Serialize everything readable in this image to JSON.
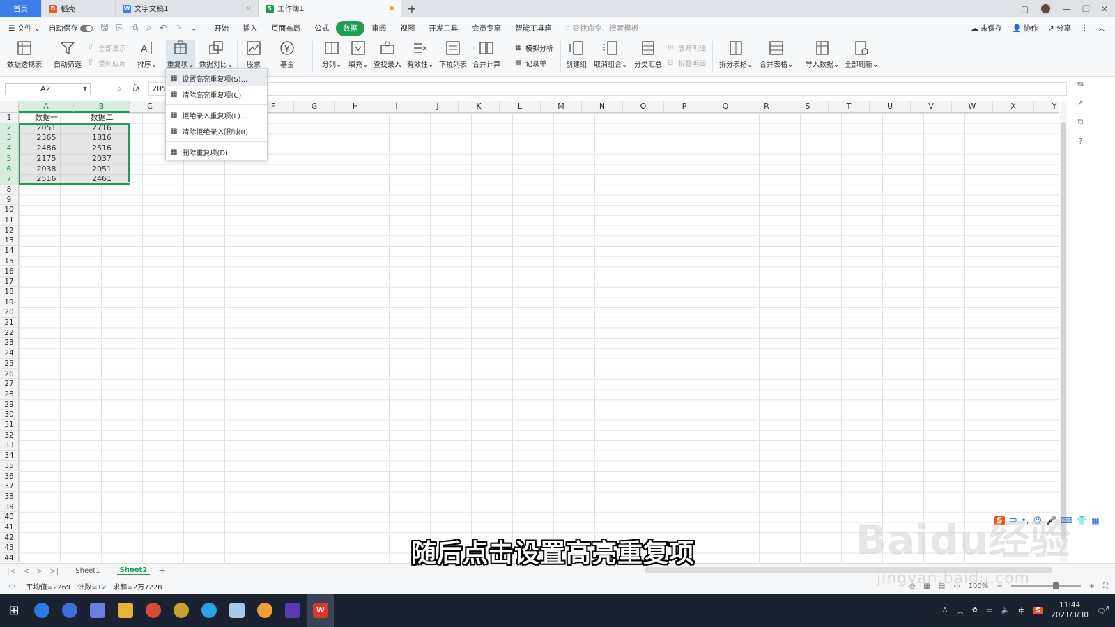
{
  "tabs": {
    "home": "首页",
    "doc1": "稻壳",
    "doc2": "文字文稿1",
    "doc3": "工作簿1"
  },
  "menubar": {
    "file": "文件",
    "autosave": "自动保存",
    "tabs": [
      "开始",
      "插入",
      "页面布局",
      "公式",
      "数据",
      "审阅",
      "视图",
      "开发工具",
      "会员专享",
      "智能工具箱"
    ],
    "active_tab": "数据",
    "search_placeholder": "查找命令、搜索模板",
    "unsaved": "未保存",
    "collab": "协作",
    "share": "分享"
  },
  "ribbon": {
    "pivot": "数据透视表",
    "autofilter": "自动筛选",
    "showall": "全部显示",
    "reapply": "重新应用",
    "sort": "排序",
    "duplicates": "重复项",
    "compare": "数据对比",
    "stocks": "股票",
    "funds": "基金",
    "split": "分列",
    "fill": "填充",
    "lookup": "查找录入",
    "validity": "有效性",
    "dropdown": "下拉列表",
    "consolidate": "合并计算",
    "simulate": "模拟分析",
    "record": "记录单",
    "group": "创建组",
    "ungroup": "取消组合",
    "subtotal": "分类汇总",
    "expand": "展开明细",
    "collapse": "折叠明细",
    "splittable": "拆分表格",
    "mergetable": "合并表格",
    "import": "导入数据",
    "refreshall": "全部刷新"
  },
  "formulabar": {
    "namebox": "A2",
    "fx": "fx",
    "content": "205"
  },
  "columns": [
    "A",
    "B",
    "C",
    "D",
    "E",
    "F",
    "G",
    "H",
    "I",
    "J",
    "K",
    "L",
    "M",
    "N",
    "O",
    "P",
    "Q",
    "R",
    "S",
    "T",
    "U",
    "V",
    "W",
    "X",
    "Y"
  ],
  "headers": [
    "数据一",
    "数据二"
  ],
  "table": [
    [
      "2051",
      "2716"
    ],
    [
      "2365",
      "1816"
    ],
    [
      "2486",
      "2516"
    ],
    [
      "2175",
      "2037"
    ],
    [
      "2038",
      "2051"
    ],
    [
      "2516",
      "2461"
    ]
  ],
  "dropdown": [
    "设置高亮重复项(S)...",
    "清除高亮重复项(C)",
    "拒绝录入重复项(L)...",
    "清除拒绝录入限制(R)",
    "删除重复项(D)"
  ],
  "sheets": [
    "Sheet1",
    "Sheet2"
  ],
  "active_sheet": "Sheet2",
  "status": {
    "average": "平均值=2269",
    "count": "计数=12",
    "sum": "求和=2万7228",
    "zoom": "100%"
  },
  "taskbar": {
    "time": "11:44",
    "date": "2021/3/30",
    "ime_lang": "中",
    "notif_count": "8"
  },
  "ime": {
    "mode": "中"
  },
  "subtitle": "随后点击设置高亮重复项",
  "watermark": {
    "brand": "Baidu经验",
    "url": "jingyan.baidu.com"
  },
  "colors": {
    "accent": "#1f9d55",
    "home_tab": "#3f7de9",
    "taskbar": "#1a2130"
  }
}
